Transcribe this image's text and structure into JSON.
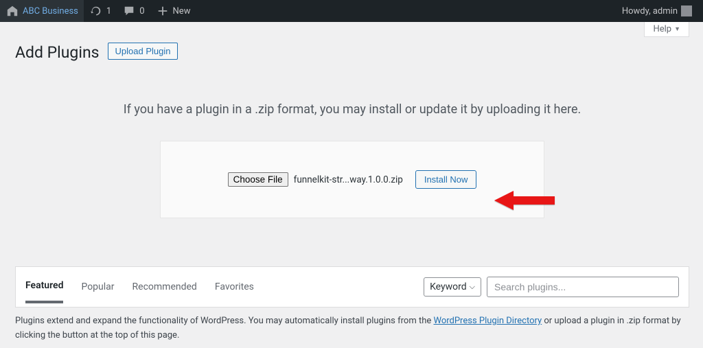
{
  "adminbar": {
    "site_name": "ABC Business",
    "updates_count": "1",
    "comments_count": "0",
    "new_label": "New",
    "howdy": "Howdy, admin"
  },
  "header": {
    "page_title": "Add Plugins",
    "upload_button": "Upload Plugin",
    "help_label": "Help"
  },
  "upload": {
    "intro": "If you have a plugin in a .zip format, you may install or update it by uploading it here.",
    "choose_file": "Choose File",
    "filename": "funnelkit-str...way.1.0.0.zip",
    "install_now": "Install Now"
  },
  "filter": {
    "tabs": [
      "Featured",
      "Popular",
      "Recommended",
      "Favorites"
    ],
    "active_tab": 0,
    "keyword_label": "Keyword",
    "search_placeholder": "Search plugins..."
  },
  "description": {
    "pre": "Plugins extend and expand the functionality of WordPress. You may automatically install plugins from the ",
    "link_text": "WordPress Plugin Directory",
    "post": " or upload a plugin in .zip format by clicking the button at the top of this page."
  }
}
